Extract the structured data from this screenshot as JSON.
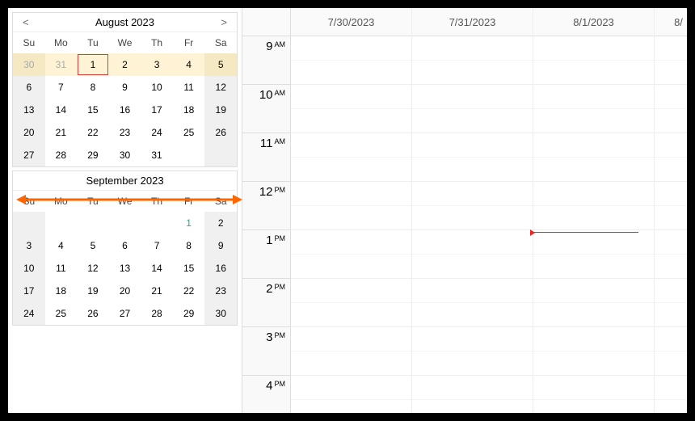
{
  "calendars": [
    {
      "title": "August 2023",
      "prev": "<",
      "next": ">",
      "showNav": true,
      "dayHeaders": [
        "Su",
        "Mo",
        "Tu",
        "We",
        "Th",
        "Fr",
        "Sa"
      ],
      "weeks": [
        [
          {
            "n": "30",
            "cls": "wk off hl"
          },
          {
            "n": "31",
            "cls": "off hl"
          },
          {
            "n": "1",
            "cls": "hl sel"
          },
          {
            "n": "2",
            "cls": "hl"
          },
          {
            "n": "3",
            "cls": "hl"
          },
          {
            "n": "4",
            "cls": "hl"
          },
          {
            "n": "5",
            "cls": "wk hl"
          }
        ],
        [
          {
            "n": "6",
            "cls": "wk"
          },
          {
            "n": "7",
            "cls": ""
          },
          {
            "n": "8",
            "cls": ""
          },
          {
            "n": "9",
            "cls": ""
          },
          {
            "n": "10",
            "cls": ""
          },
          {
            "n": "11",
            "cls": ""
          },
          {
            "n": "12",
            "cls": "wk"
          }
        ],
        [
          {
            "n": "13",
            "cls": "wk"
          },
          {
            "n": "14",
            "cls": ""
          },
          {
            "n": "15",
            "cls": ""
          },
          {
            "n": "16",
            "cls": ""
          },
          {
            "n": "17",
            "cls": ""
          },
          {
            "n": "18",
            "cls": ""
          },
          {
            "n": "19",
            "cls": "wk"
          }
        ],
        [
          {
            "n": "20",
            "cls": "wk"
          },
          {
            "n": "21",
            "cls": ""
          },
          {
            "n": "22",
            "cls": ""
          },
          {
            "n": "23",
            "cls": ""
          },
          {
            "n": "24",
            "cls": ""
          },
          {
            "n": "25",
            "cls": ""
          },
          {
            "n": "26",
            "cls": "wk"
          }
        ],
        [
          {
            "n": "27",
            "cls": "wk"
          },
          {
            "n": "28",
            "cls": ""
          },
          {
            "n": "29",
            "cls": ""
          },
          {
            "n": "30",
            "cls": ""
          },
          {
            "n": "31",
            "cls": ""
          },
          {
            "n": "",
            "cls": ""
          },
          {
            "n": "",
            "cls": "wk"
          }
        ]
      ]
    },
    {
      "title": "September 2023",
      "showNav": false,
      "dayHeaders": [
        "Su",
        "Mo",
        "Tu",
        "We",
        "Th",
        "Fr",
        "Sa"
      ],
      "weeks": [
        [
          {
            "n": "",
            "cls": "wk"
          },
          {
            "n": "",
            "cls": ""
          },
          {
            "n": "",
            "cls": ""
          },
          {
            "n": "",
            "cls": ""
          },
          {
            "n": "",
            "cls": ""
          },
          {
            "n": "1",
            "cls": "spec"
          },
          {
            "n": "2",
            "cls": "wk"
          }
        ],
        [
          {
            "n": "3",
            "cls": "wk"
          },
          {
            "n": "4",
            "cls": ""
          },
          {
            "n": "5",
            "cls": ""
          },
          {
            "n": "6",
            "cls": ""
          },
          {
            "n": "7",
            "cls": ""
          },
          {
            "n": "8",
            "cls": ""
          },
          {
            "n": "9",
            "cls": "wk"
          }
        ],
        [
          {
            "n": "10",
            "cls": "wk"
          },
          {
            "n": "11",
            "cls": ""
          },
          {
            "n": "12",
            "cls": ""
          },
          {
            "n": "13",
            "cls": ""
          },
          {
            "n": "14",
            "cls": ""
          },
          {
            "n": "15",
            "cls": ""
          },
          {
            "n": "16",
            "cls": "wk"
          }
        ],
        [
          {
            "n": "17",
            "cls": "wk"
          },
          {
            "n": "18",
            "cls": ""
          },
          {
            "n": "19",
            "cls": ""
          },
          {
            "n": "20",
            "cls": ""
          },
          {
            "n": "21",
            "cls": ""
          },
          {
            "n": "22",
            "cls": ""
          },
          {
            "n": "23",
            "cls": "wk"
          }
        ],
        [
          {
            "n": "24",
            "cls": "wk"
          },
          {
            "n": "25",
            "cls": ""
          },
          {
            "n": "26",
            "cls": ""
          },
          {
            "n": "27",
            "cls": ""
          },
          {
            "n": "28",
            "cls": ""
          },
          {
            "n": "29",
            "cls": ""
          },
          {
            "n": "30",
            "cls": "wk"
          }
        ]
      ]
    }
  ],
  "scheduler": {
    "dates": [
      "7/30/2023",
      "7/31/2023",
      "8/1/2023",
      "8/"
    ],
    "hours": [
      {
        "h": "9",
        "ap": "AM"
      },
      {
        "h": "10",
        "ap": "AM"
      },
      {
        "h": "11",
        "ap": "AM"
      },
      {
        "h": "12",
        "ap": "PM"
      },
      {
        "h": "1",
        "ap": "PM"
      },
      {
        "h": "2",
        "ap": "PM"
      },
      {
        "h": "3",
        "ap": "PM"
      },
      {
        "h": "4",
        "ap": "PM"
      }
    ]
  }
}
